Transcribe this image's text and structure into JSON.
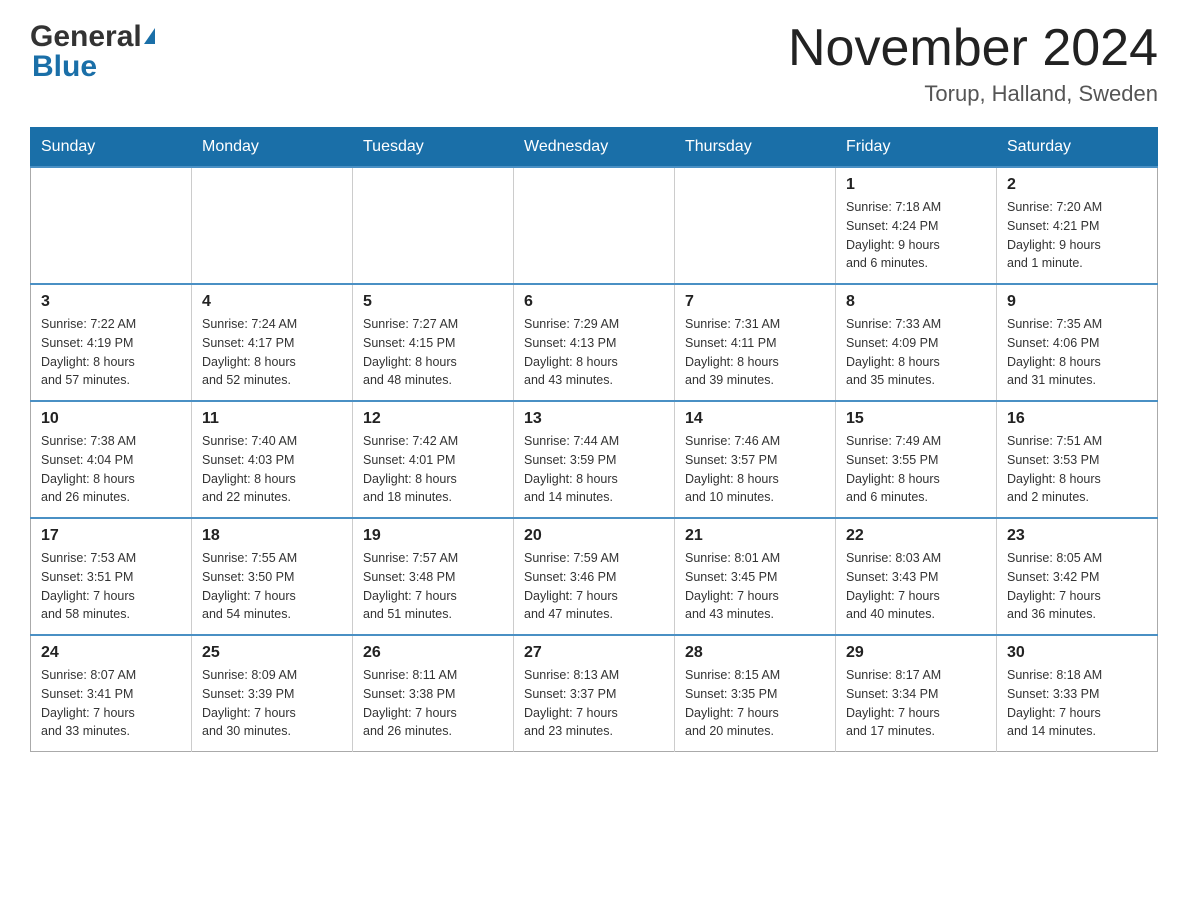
{
  "header": {
    "title": "November 2024",
    "subtitle": "Torup, Halland, Sweden",
    "logo_general": "General",
    "logo_blue": "Blue"
  },
  "weekdays": [
    "Sunday",
    "Monday",
    "Tuesday",
    "Wednesday",
    "Thursday",
    "Friday",
    "Saturday"
  ],
  "weeks": [
    {
      "days": [
        {
          "number": "",
          "info": ""
        },
        {
          "number": "",
          "info": ""
        },
        {
          "number": "",
          "info": ""
        },
        {
          "number": "",
          "info": ""
        },
        {
          "number": "",
          "info": ""
        },
        {
          "number": "1",
          "info": "Sunrise: 7:18 AM\nSunset: 4:24 PM\nDaylight: 9 hours\nand 6 minutes."
        },
        {
          "number": "2",
          "info": "Sunrise: 7:20 AM\nSunset: 4:21 PM\nDaylight: 9 hours\nand 1 minute."
        }
      ]
    },
    {
      "days": [
        {
          "number": "3",
          "info": "Sunrise: 7:22 AM\nSunset: 4:19 PM\nDaylight: 8 hours\nand 57 minutes."
        },
        {
          "number": "4",
          "info": "Sunrise: 7:24 AM\nSunset: 4:17 PM\nDaylight: 8 hours\nand 52 minutes."
        },
        {
          "number": "5",
          "info": "Sunrise: 7:27 AM\nSunset: 4:15 PM\nDaylight: 8 hours\nand 48 minutes."
        },
        {
          "number": "6",
          "info": "Sunrise: 7:29 AM\nSunset: 4:13 PM\nDaylight: 8 hours\nand 43 minutes."
        },
        {
          "number": "7",
          "info": "Sunrise: 7:31 AM\nSunset: 4:11 PM\nDaylight: 8 hours\nand 39 minutes."
        },
        {
          "number": "8",
          "info": "Sunrise: 7:33 AM\nSunset: 4:09 PM\nDaylight: 8 hours\nand 35 minutes."
        },
        {
          "number": "9",
          "info": "Sunrise: 7:35 AM\nSunset: 4:06 PM\nDaylight: 8 hours\nand 31 minutes."
        }
      ]
    },
    {
      "days": [
        {
          "number": "10",
          "info": "Sunrise: 7:38 AM\nSunset: 4:04 PM\nDaylight: 8 hours\nand 26 minutes."
        },
        {
          "number": "11",
          "info": "Sunrise: 7:40 AM\nSunset: 4:03 PM\nDaylight: 8 hours\nand 22 minutes."
        },
        {
          "number": "12",
          "info": "Sunrise: 7:42 AM\nSunset: 4:01 PM\nDaylight: 8 hours\nand 18 minutes."
        },
        {
          "number": "13",
          "info": "Sunrise: 7:44 AM\nSunset: 3:59 PM\nDaylight: 8 hours\nand 14 minutes."
        },
        {
          "number": "14",
          "info": "Sunrise: 7:46 AM\nSunset: 3:57 PM\nDaylight: 8 hours\nand 10 minutes."
        },
        {
          "number": "15",
          "info": "Sunrise: 7:49 AM\nSunset: 3:55 PM\nDaylight: 8 hours\nand 6 minutes."
        },
        {
          "number": "16",
          "info": "Sunrise: 7:51 AM\nSunset: 3:53 PM\nDaylight: 8 hours\nand 2 minutes."
        }
      ]
    },
    {
      "days": [
        {
          "number": "17",
          "info": "Sunrise: 7:53 AM\nSunset: 3:51 PM\nDaylight: 7 hours\nand 58 minutes."
        },
        {
          "number": "18",
          "info": "Sunrise: 7:55 AM\nSunset: 3:50 PM\nDaylight: 7 hours\nand 54 minutes."
        },
        {
          "number": "19",
          "info": "Sunrise: 7:57 AM\nSunset: 3:48 PM\nDaylight: 7 hours\nand 51 minutes."
        },
        {
          "number": "20",
          "info": "Sunrise: 7:59 AM\nSunset: 3:46 PM\nDaylight: 7 hours\nand 47 minutes."
        },
        {
          "number": "21",
          "info": "Sunrise: 8:01 AM\nSunset: 3:45 PM\nDaylight: 7 hours\nand 43 minutes."
        },
        {
          "number": "22",
          "info": "Sunrise: 8:03 AM\nSunset: 3:43 PM\nDaylight: 7 hours\nand 40 minutes."
        },
        {
          "number": "23",
          "info": "Sunrise: 8:05 AM\nSunset: 3:42 PM\nDaylight: 7 hours\nand 36 minutes."
        }
      ]
    },
    {
      "days": [
        {
          "number": "24",
          "info": "Sunrise: 8:07 AM\nSunset: 3:41 PM\nDaylight: 7 hours\nand 33 minutes."
        },
        {
          "number": "25",
          "info": "Sunrise: 8:09 AM\nSunset: 3:39 PM\nDaylight: 7 hours\nand 30 minutes."
        },
        {
          "number": "26",
          "info": "Sunrise: 8:11 AM\nSunset: 3:38 PM\nDaylight: 7 hours\nand 26 minutes."
        },
        {
          "number": "27",
          "info": "Sunrise: 8:13 AM\nSunset: 3:37 PM\nDaylight: 7 hours\nand 23 minutes."
        },
        {
          "number": "28",
          "info": "Sunrise: 8:15 AM\nSunset: 3:35 PM\nDaylight: 7 hours\nand 20 minutes."
        },
        {
          "number": "29",
          "info": "Sunrise: 8:17 AM\nSunset: 3:34 PM\nDaylight: 7 hours\nand 17 minutes."
        },
        {
          "number": "30",
          "info": "Sunrise: 8:18 AM\nSunset: 3:33 PM\nDaylight: 7 hours\nand 14 minutes."
        }
      ]
    }
  ]
}
